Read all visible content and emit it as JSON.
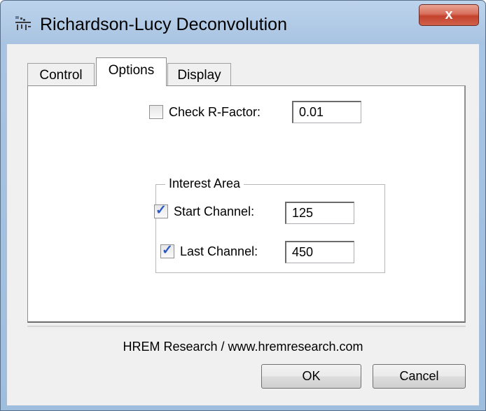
{
  "window": {
    "title": "Richardson-Lucy Deconvolution",
    "close_glyph": "x",
    "icon": "app-icon"
  },
  "tabs": [
    {
      "label": "Control",
      "selected": false
    },
    {
      "label": "Options",
      "selected": true
    },
    {
      "label": "Display",
      "selected": false
    }
  ],
  "options": {
    "check_r_factor": {
      "label": "Check R-Factor:",
      "checked": false,
      "value": "0.01"
    },
    "interest_area": {
      "legend": "Interest Area",
      "start_channel": {
        "label": "Start Channel:",
        "checked": true,
        "value": "125"
      },
      "last_channel": {
        "label": "Last Channel:",
        "checked": true,
        "value": "450"
      }
    }
  },
  "footer": {
    "text": "HREM Research / www.hremresearch.com"
  },
  "buttons": {
    "ok": "OK",
    "cancel": "Cancel"
  },
  "colors": {
    "close_button": "#c4412c",
    "checkmark": "#2a58c4",
    "frame": "#a9c4e2"
  }
}
